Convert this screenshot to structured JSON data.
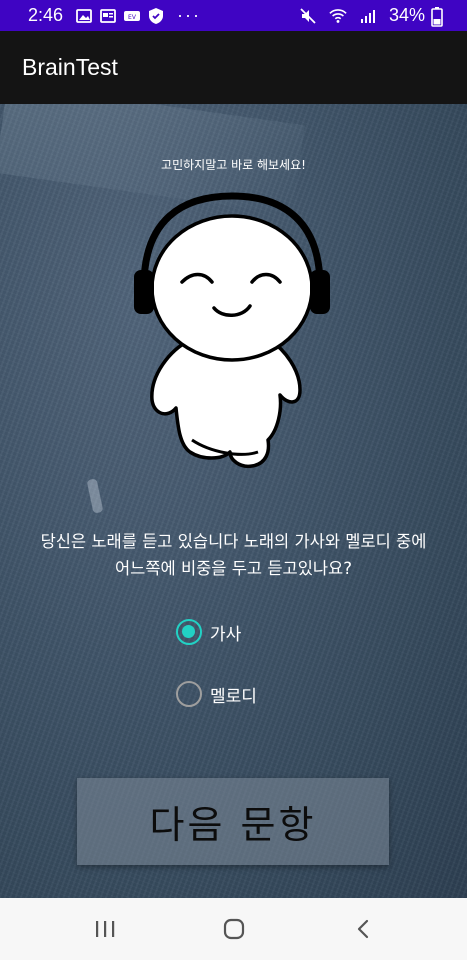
{
  "status_bar": {
    "time": "2:46",
    "overflow": "···",
    "battery": "34%",
    "icons_left": [
      "image-icon",
      "news-icon",
      "screen-record-icon",
      "vpn-shield-icon"
    ],
    "icons_right": [
      "mute-icon",
      "wifi-icon",
      "signal-icon",
      "battery-icon"
    ]
  },
  "app_bar": {
    "title": "BrainTest"
  },
  "main": {
    "hint": "고민하지말고 바로 해보세요!",
    "question_line1": "당신은 노래를 듣고 있습니다 노래의 가사와 멜로디 중에",
    "question_line2": "어느쪽에 비중을 두고 듣고있나요?",
    "options": [
      {
        "label": "가사",
        "checked": true
      },
      {
        "label": "멜로디",
        "checked": false
      }
    ],
    "next_button": "다음 문항"
  },
  "colors": {
    "status_bar": "#3f04c3",
    "app_bar": "#141414",
    "accent": "#22d1c4",
    "background": "#3f5468"
  },
  "nav_bar": {
    "icons": [
      "recent-apps-icon",
      "home-icon",
      "back-icon"
    ]
  }
}
